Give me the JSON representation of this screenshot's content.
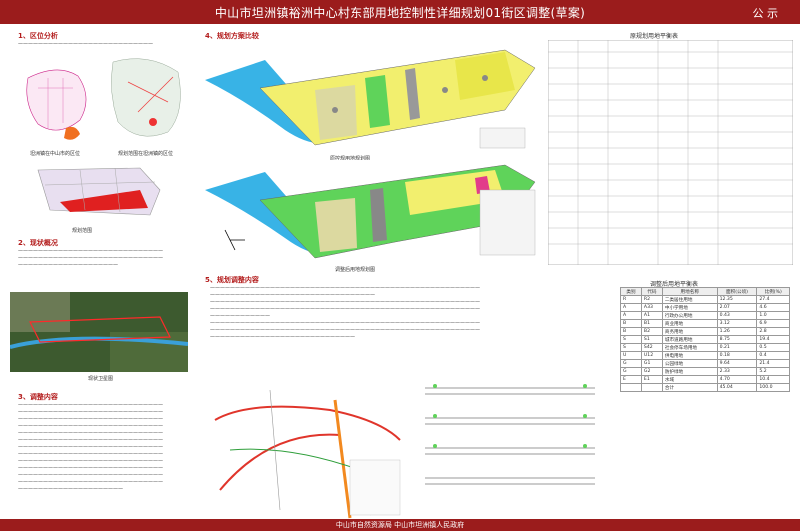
{
  "header": {
    "title": "中山市坦洲镇裕洲中心村东部用地控制性详细规划01街区调整(草案)",
    "badge": "公 示"
  },
  "left": {
    "sec1": "1、区位分析",
    "sec1_caption_a": "坦洲镇在中山市的区位",
    "sec1_caption_b": "规划范围在坦洲镇的区位",
    "sec1_caption_c": "规划范围",
    "sec2": "2、现状概况",
    "sec2_caption": "现状卫星图",
    "sec3": "3、调整内容"
  },
  "mid": {
    "sec4": "4、规划方案比较",
    "map_caption_a": "原控规用地规划图",
    "map_caption_b": "调整后用地规划图",
    "sec5": "5、规划调整内容"
  },
  "right": {
    "tbl1_title": "原规划用地平衡表",
    "tbl2_title": "调整后用地平衡表",
    "tbl2_headers": [
      "类别",
      "代码",
      "用地名称",
      "面积(公顷)",
      "比例(%)"
    ],
    "tbl2_rows": [
      [
        "R",
        "R2",
        "二类居住用地",
        "12.35",
        "27.4"
      ],
      [
        "A",
        "A33",
        "中小学用地",
        "2.07",
        "4.6"
      ],
      [
        "A",
        "A1",
        "行政办公用地",
        "0.43",
        "1.0"
      ],
      [
        "B",
        "B1",
        "商业用地",
        "3.12",
        "6.9"
      ],
      [
        "B",
        "B2",
        "商务用地",
        "1.26",
        "2.8"
      ],
      [
        "S",
        "S1",
        "城市道路用地",
        "8.75",
        "19.4"
      ],
      [
        "S",
        "S42",
        "社会停车场用地",
        "0.21",
        "0.5"
      ],
      [
        "U",
        "U12",
        "供电用地",
        "0.18",
        "0.4"
      ],
      [
        "G",
        "G1",
        "公园绿地",
        "9.64",
        "21.4"
      ],
      [
        "G",
        "G2",
        "防护绿地",
        "2.33",
        "5.2"
      ],
      [
        "E",
        "E1",
        "水域",
        "4.70",
        "10.4"
      ],
      [
        "",
        "",
        "合计",
        "45.04",
        "100.0"
      ]
    ]
  },
  "footer": {
    "text": "中山市自然资源局  中山市坦洲镇人民政府"
  },
  "colors": {
    "header": "#9b1c1c",
    "residential": "#f2ef6e",
    "green": "#5fd35a",
    "water": "#38b3e6",
    "road": "#e0352b"
  }
}
